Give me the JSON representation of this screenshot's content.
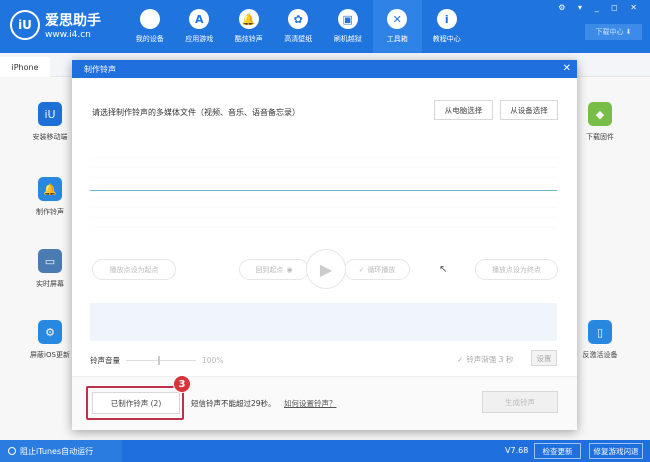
{
  "app": {
    "logo_mark": "iU",
    "name": "爱思助手",
    "url": "www.i4.cn"
  },
  "nav": [
    {
      "label": "我的设备",
      "icon": ""
    },
    {
      "label": "应用游戏",
      "icon": "A"
    },
    {
      "label": "酷炫铃声",
      "icon": "🔔"
    },
    {
      "label": "高清壁纸",
      "icon": "✿"
    },
    {
      "label": "刷机越狱",
      "icon": "▣"
    },
    {
      "label": "工具箱",
      "icon": "✕"
    },
    {
      "label": "教程中心",
      "icon": "i"
    }
  ],
  "window_controls": "⚙ ▾ _ ◻ ✕",
  "download_center": "下载中心 ⬇",
  "tab": "iPhone",
  "left_tools": [
    "安装移动端",
    "制作铃声",
    "实时屏幕",
    "屏蔽iOS更新"
  ],
  "right_tools": [
    "下载固件",
    "反激活设备"
  ],
  "modal": {
    "title": "制作铃声",
    "close": "✕",
    "prompt": "请选择制作铃声的多媒体文件（视频、音乐、语音备忘录）",
    "from_pc": "从电脑选择",
    "from_device": "从设备选择",
    "set_start": "播放点设为起点",
    "back_to_start": "回到起点",
    "loop": "循环播放",
    "set_end": "播放点设为终点",
    "volume_label": "铃声音量",
    "volume_value": "100%",
    "volume_fraction": 0.45,
    "fade_label": "铃声渐强 3 秒",
    "settings": "设置",
    "made_ringtones": "已制作铃声 (2)",
    "sms_note": "短信铃声不能超过29秒。",
    "how_link": "如何设置铃声？",
    "generate": "生成铃声",
    "step_badge": "3"
  },
  "status": {
    "itunes": "阻止iTunes自动运行",
    "version": "V7.68",
    "check_update": "检查更新",
    "repair": "修复游戏闪退"
  }
}
